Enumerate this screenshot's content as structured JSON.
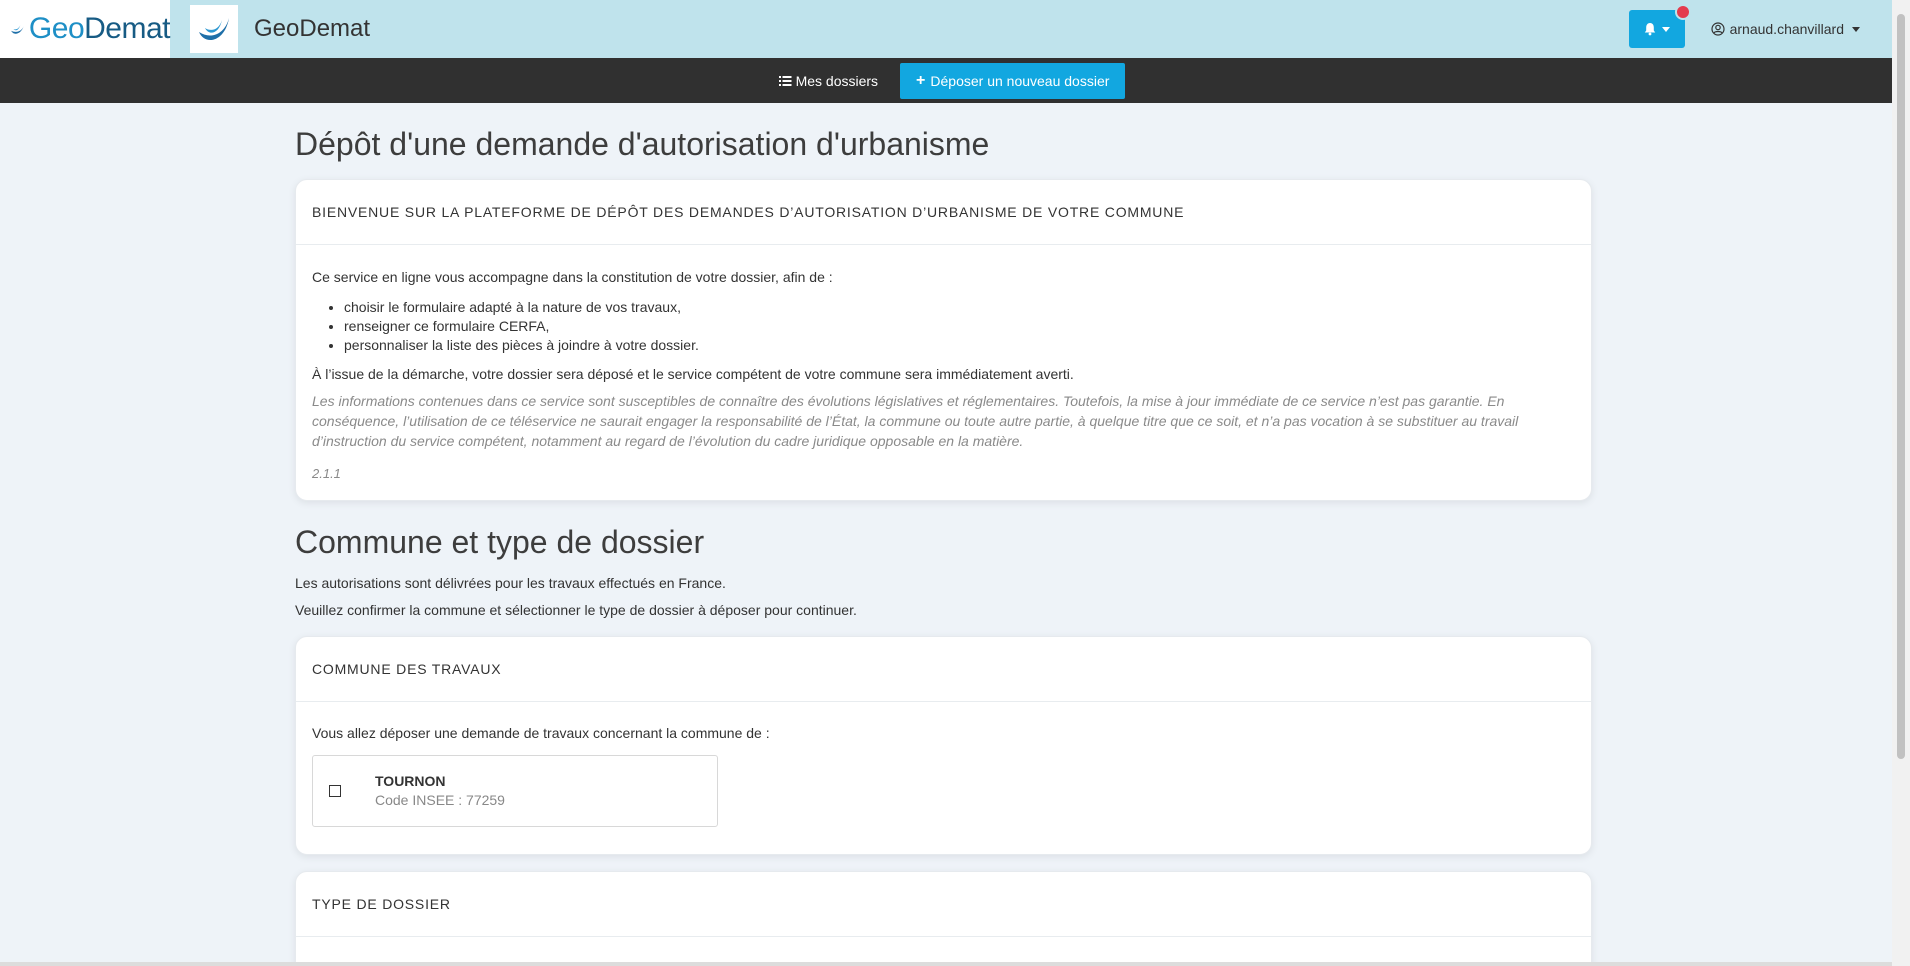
{
  "header": {
    "brand_geo": "Geo",
    "brand_demat": "Demat",
    "app_name": "GeoDemat",
    "user_name": "arnaud.chanvillard"
  },
  "nav": {
    "my_folders": "Mes dossiers",
    "new_folder": "Déposer un nouveau dossier"
  },
  "page": {
    "title": "Dépôt d'une demande d'autorisation d'urbanisme"
  },
  "welcome_card": {
    "header": "BIENVENUE SUR LA PLATEFORME DE DÉPÔT DES DEMANDES D’AUTORISATION D’URBANISME DE VOTRE COMMUNE",
    "intro": "Ce service en ligne vous accompagne dans la constitution de votre dossier, afin de :",
    "items": [
      "choisir le formulaire adapté à la nature de vos travaux,",
      "renseigner ce formulaire CERFA,",
      "personnaliser la liste des pièces à joindre à votre dossier."
    ],
    "outcome": "À l’issue de la démarche, votre dossier sera déposé et le service compétent de votre commune sera immédiatement averti.",
    "disclaimer": "Les informations contenues dans ce service sont susceptibles de connaître des évolutions législatives et réglementaires. Toutefois, la mise à jour immédiate de ce service n’est pas garantie. En conséquence, l’utilisation de ce téléservice ne saurait engager la responsabilité de l’État, la commune ou toute autre partie, à quelque titre que ce soit, et n’a pas vocation à se substituer au travail d’instruction du service compétent, notamment au regard de l’évolution du cadre juridique opposable en la matière.",
    "version": "2.1.1"
  },
  "section": {
    "title": "Commune et type de dossier",
    "line1": "Les autorisations sont délivrées pour les travaux effectués en France.",
    "line2": "Veuillez confirmer la commune et sélectionner le type de dossier à déposer pour continuer."
  },
  "commune_card": {
    "header": "COMMUNE DES TRAVAUX",
    "intro": "Vous allez déposer une demande de travaux concernant la commune de :",
    "commune_name": "TOURNON",
    "commune_code": "Code INSEE : 77259"
  },
  "type_card": {
    "header": "TYPE DE DOSSIER"
  },
  "colors": {
    "header_bg": "#bfe3ec",
    "nav_bg": "#303030",
    "accent": "#12a7e0",
    "badge": "#e43b4d"
  }
}
